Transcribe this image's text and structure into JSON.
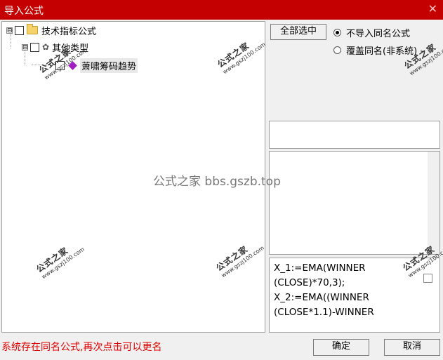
{
  "window": {
    "title": "导入公式",
    "close_glyph": "✕"
  },
  "tree": {
    "items": [
      {
        "label": "技术指标公式",
        "level": 0,
        "expander": "⊟"
      },
      {
        "label": "其他类型",
        "level": 1,
        "expander": "⊟"
      },
      {
        "label": "萧啸筹码趋势",
        "level": 2
      }
    ]
  },
  "buttons": {
    "select_all": "全部选中",
    "ok": "确定",
    "cancel": "取消"
  },
  "options": {
    "no_import_same_name": "不导入同名公式",
    "overwrite_same_name": "覆盖同名(非系统)",
    "selected_index": 0
  },
  "formula_text": [
    "X_1:=EMA(WINNER",
    "(CLOSE)*70,3);",
    "X_2:=EMA((WINNER",
    "(CLOSE*1.1)-WINNER"
  ],
  "status_message": "系统存在同名公式,再次点击可以更名",
  "watermarks": {
    "center": "公式之家 bbs.gszb.top",
    "stamp_text": "公式之家",
    "stamp_url": "www.gszj100.com"
  }
}
